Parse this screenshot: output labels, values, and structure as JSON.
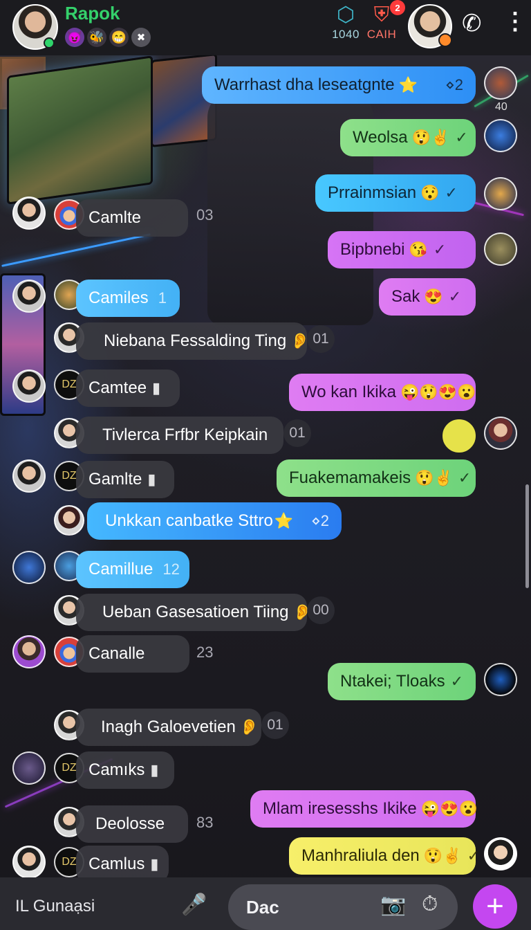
{
  "header": {
    "contact_name": "Rapok",
    "status_emojis": [
      "😈",
      "🐝",
      "😁",
      "✖"
    ],
    "icon1_label": "1040",
    "icon2_label": "CAIH",
    "icon2_badge": "2"
  },
  "messages": [
    {
      "text": "Warrhast  dha leseatgnte",
      "emoji": "⭐",
      "status": "⋄2"
    },
    {
      "text": "Weolsa",
      "emoji": "😲✌",
      "status": "✓"
    },
    {
      "text": "Prrainmsian",
      "emoji": "😯",
      "status": "✓"
    },
    {
      "text": "Bipbnebi",
      "emoji": "😘",
      "status": "✓"
    },
    {
      "text": "Sak",
      "emoji": "😍",
      "status": "✓"
    },
    {
      "text": "Camlte",
      "count": "03"
    },
    {
      "text": "Camiles",
      "count": "1"
    },
    {
      "text": "Niebana Fessalding Ting",
      "emoji": "👂",
      "count": "01"
    },
    {
      "text": "Camtee",
      "status": "▮"
    },
    {
      "text": "Wo kan Ikika",
      "emoji": "😜😲😍😮"
    },
    {
      "text": "Tivlerca Frfbr Keipkain",
      "count": "01"
    },
    {
      "text": "Gamlte",
      "status": "▮"
    },
    {
      "text": "Fuakemamakeis",
      "emoji": "😲✌",
      "status": "✓"
    },
    {
      "text": "Unkkan canbatke Sttro",
      "emoji": "⭐",
      "status": "⋄2"
    },
    {
      "text": "Camillue",
      "count": "12"
    },
    {
      "text": "Ueban Gasesatioen Tiing",
      "emoji": "👂",
      "count": "00"
    },
    {
      "text": "Canalle",
      "count": "23"
    },
    {
      "text": "Ntakei; Tloaks",
      "status": "✓"
    },
    {
      "text": "Inagh Galoevetien",
      "emoji": "👂",
      "count": "01"
    },
    {
      "text": "Camıks",
      "status": "▮"
    },
    {
      "text": "Mlam iresesshs Ikike",
      "emoji": "😜😍😮"
    },
    {
      "text": "Deolosse",
      "count": "83"
    },
    {
      "text": "Camlus",
      "status": "▮"
    },
    {
      "text": "Manhraliula den",
      "emoji": "😲✌",
      "status": "✓"
    }
  ],
  "side_badge": "40",
  "composer": {
    "label": "IL Gunaạsi",
    "placeholder": "Dac"
  }
}
